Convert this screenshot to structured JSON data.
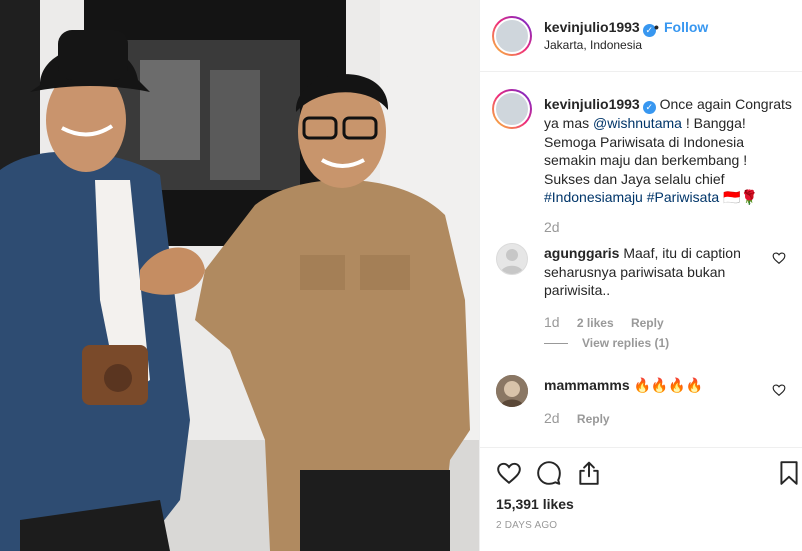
{
  "post": {
    "username": "kevinjulio1993",
    "location": "Jakarta, Indonesia",
    "follow_label": "Follow",
    "header_separator": "•",
    "verified_mark": "✓"
  },
  "caption": {
    "username": "kevinjulio1993",
    "text_1": "Once again Congrats ya mas ",
    "mention": "@wishnutama",
    "text_2": " ! Bangga! Semoga Pariwisata di Indonesia semakin maju dan berkembang ! Sukses dan Jaya selalu chief ",
    "hashtag_1": "#Indonesiamaju",
    "hashtag_2": "#Pariwisata",
    "emoji": "🇮🇩🌹",
    "time": "2d"
  },
  "comments": [
    {
      "username": "agunggaris",
      "text": "Maaf, itu di caption seharusnya pariwisata bukan pariwisita..",
      "time": "1d",
      "likes": "2 likes",
      "reply_label": "Reply",
      "view_replies": "View replies (1)"
    },
    {
      "username": "mammamms",
      "text": "🔥🔥🔥🔥",
      "time": "2d",
      "reply_label": "Reply"
    }
  ],
  "footer": {
    "likes": "15,391 likes",
    "time_ago": "2 DAYS AGO"
  },
  "icons": {
    "like": "heart-icon",
    "comment": "comment-icon",
    "share": "share-icon",
    "save": "bookmark-icon"
  },
  "colors": {
    "link": "#003569",
    "follow": "#3897f0",
    "muted": "#999999"
  }
}
